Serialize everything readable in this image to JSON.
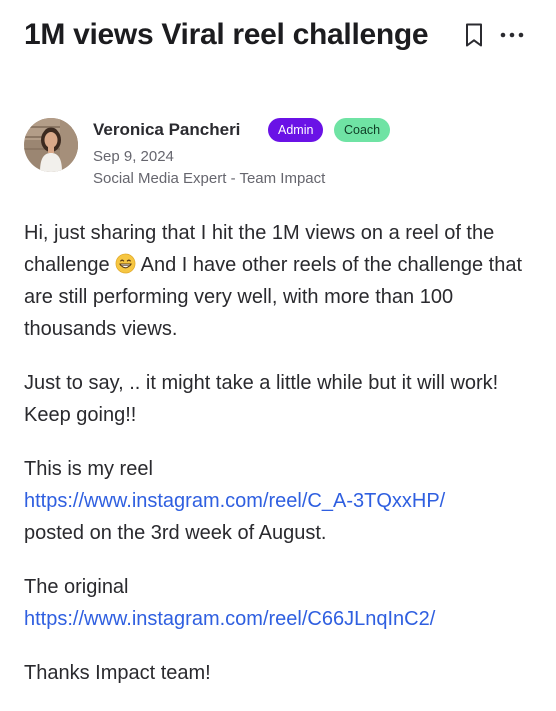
{
  "post": {
    "title": "1M views Viral reel challenge"
  },
  "actions": {
    "bookmark_icon": "bookmark-icon",
    "more_icon": "more-horizontal-icon"
  },
  "author": {
    "name": "Veronica Pancheri",
    "badges": {
      "admin": "Admin",
      "coach": "Coach"
    },
    "date": "Sep 9, 2024",
    "role": "Social Media Expert - Team Impact"
  },
  "content": {
    "p1_before_emoji": "Hi, just sharing that I hit the 1M views on a reel of the challenge",
    "p1_emoji": "grinning-face-icon",
    "p1_after_emoji": " And I have other reels of the challenge that are still performing very well, with more than 100 thousands views.",
    "p2": "Just to say, .. it might take a little while but it will work! Keep going!!",
    "p3_lead": "This is my reel",
    "p3_link": "https://www.instagram.com/reel/C_A-3TQxxHP/",
    "p3_tail": "posted on the 3rd week of August.",
    "p4_lead": "The original",
    "p4_link": "https://www.instagram.com/reel/C66JLnqInC2/",
    "p5": "Thanks Impact team!"
  },
  "colors": {
    "admin_badge": "#6a12e6",
    "coach_badge": "#6fe3a4",
    "link": "#2f5fe0",
    "title": "#1c1c1f"
  }
}
